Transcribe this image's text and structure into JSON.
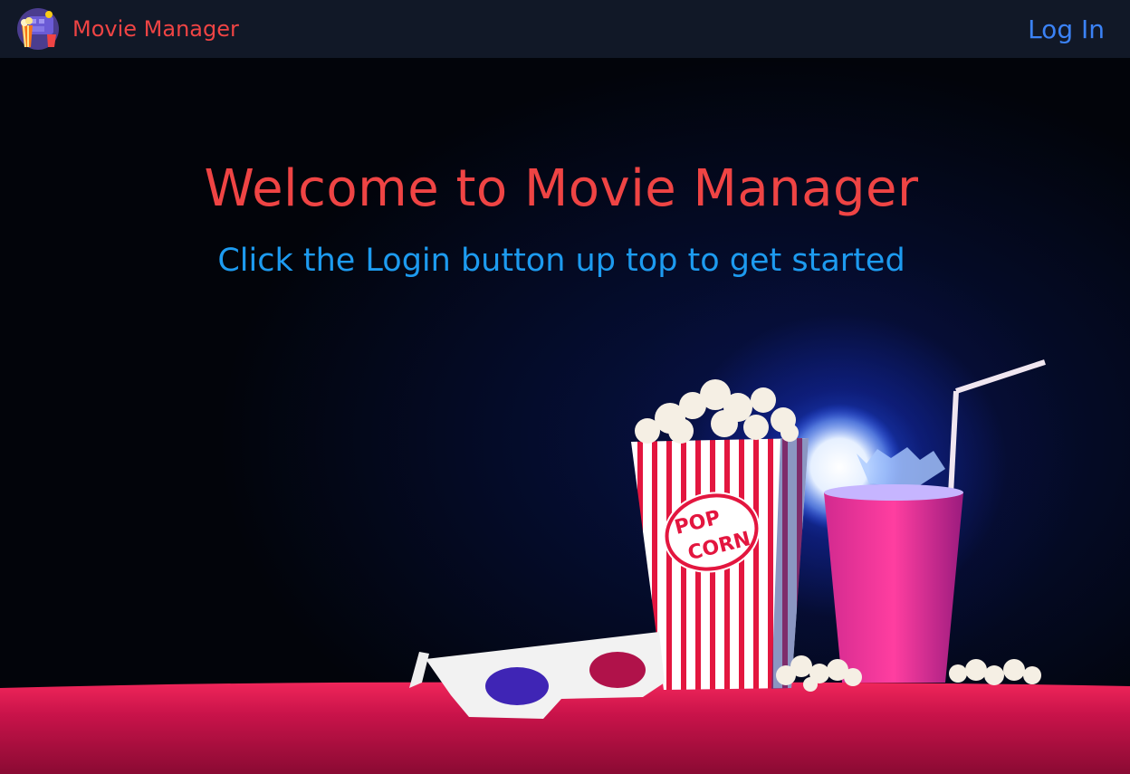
{
  "app": {
    "brand_name": "Movie Manager",
    "login_label": "Log In"
  },
  "hero": {
    "title": "Welcome to Movie Manager",
    "subtitle": "Click the Login button up top to get started",
    "popcorn_text_line1": "POP",
    "popcorn_text_line2": "CORN"
  },
  "colors": {
    "navbar_bg": "#111827",
    "brand_red": "#ef4444",
    "link_blue": "#3b82f6",
    "subtitle_blue": "#1d9bf0"
  },
  "icons": {
    "logo": "movie-clapper-popcorn-logo"
  }
}
